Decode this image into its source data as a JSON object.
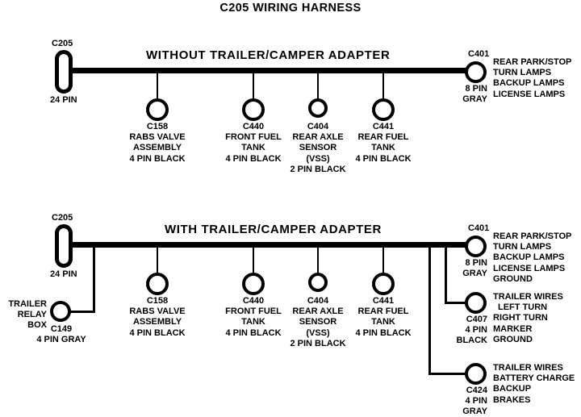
{
  "page": {
    "title": "C205 WIRING HARNESS",
    "line_color": "#000000",
    "background": "#ffffff"
  },
  "sections": [
    {
      "id": "without-adapter",
      "heading": "WITHOUT  TRAILER/CAMPER  ADAPTER",
      "source_connector": {
        "name": "C205",
        "pins": "24 PIN",
        "shape": "pill"
      },
      "end_connector": {
        "name": "C401",
        "pins": "8 PIN",
        "color": "GRAY",
        "shape": "circle",
        "functions": [
          "REAR PARK/STOP",
          "TURN LAMPS",
          "BACKUP LAMPS",
          "LICENSE LAMPS"
        ]
      },
      "drops": [
        {
          "name": "C158",
          "description": [
            "RABS VALVE",
            "ASSEMBLY"
          ],
          "spec": "4 PIN BLACK"
        },
        {
          "name": "C440",
          "description": [
            "FRONT FUEL",
            "TANK"
          ],
          "spec": "4 PIN BLACK"
        },
        {
          "name": "C404",
          "description": [
            "REAR AXLE",
            "SENSOR",
            "(VSS)"
          ],
          "spec": "2 PIN BLACK"
        },
        {
          "name": "C441",
          "description": [
            "REAR FUEL",
            "TANK"
          ],
          "spec": "4 PIN BLACK"
        }
      ]
    },
    {
      "id": "with-adapter",
      "heading": "WITH TRAILER/CAMPER  ADAPTER",
      "source_connector": {
        "name": "C205",
        "pins": "24 PIN",
        "shape": "pill"
      },
      "end_connector": {
        "name": "C401",
        "pins": "8 PIN",
        "color": "GRAY",
        "shape": "circle",
        "functions": [
          "REAR PARK/STOP",
          "TURN LAMPS",
          "BACKUP LAMPS",
          "LICENSE LAMPS",
          "GROUND"
        ]
      },
      "relay_branch": {
        "label": [
          "TRAILER",
          "RELAY",
          "BOX"
        ],
        "name": "C149",
        "spec": "4 PIN GRAY",
        "shape": "circle"
      },
      "drops": [
        {
          "name": "C158",
          "description": [
            "RABS VALVE",
            "ASSEMBLY"
          ],
          "spec": "4 PIN BLACK"
        },
        {
          "name": "C440",
          "description": [
            "FRONT FUEL",
            "TANK"
          ],
          "spec": "4 PIN BLACK"
        },
        {
          "name": "C404",
          "description": [
            "REAR AXLE",
            "SENSOR",
            "(VSS)"
          ],
          "spec": "2 PIN BLACK"
        },
        {
          "name": "C441",
          "description": [
            "REAR FUEL",
            "TANK"
          ],
          "spec": "4 PIN BLACK"
        }
      ],
      "side_branches": [
        {
          "name": "C407",
          "pins": "4 PIN",
          "color": "BLACK",
          "shape": "circle",
          "functions": [
            "TRAILER WIRES",
            "LEFT TURN",
            "RIGHT TURN",
            "MARKER",
            "GROUND"
          ]
        },
        {
          "name": "C424",
          "pins": "4 PIN",
          "color": "GRAY",
          "shape": "circle",
          "functions": [
            "TRAILER  WIRES",
            "BATTERY CHARGE",
            "BACKUP",
            "BRAKES"
          ]
        }
      ]
    }
  ]
}
